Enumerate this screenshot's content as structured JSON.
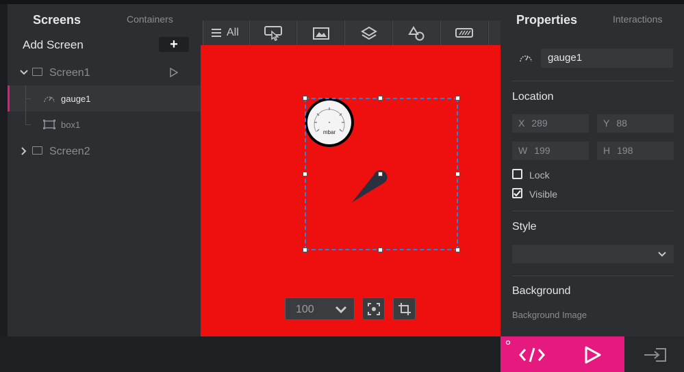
{
  "left_panel": {
    "tab_active": "Screens",
    "tab_inactive": "Containers",
    "add_screen_label": "Add Screen",
    "add_button": "+",
    "tree": {
      "screen1": "Screen1",
      "gauge1": "gauge1",
      "box1": "box1",
      "screen2": "Screen2"
    }
  },
  "toolbar": {
    "all_label": "All"
  },
  "canvas": {
    "background_color": "#ee0f0f",
    "gauge_unit": "mbar",
    "zoom_value": "100"
  },
  "right_panel": {
    "tab_active": "Properties",
    "tab_inactive": "Interactions",
    "object_name": "gauge1",
    "location_title": "Location",
    "x_label": "X",
    "x_value": "289",
    "y_label": "Y",
    "y_value": "88",
    "w_label": "W",
    "w_value": "199",
    "h_label": "H",
    "h_value": "198",
    "lock_label": "Lock",
    "lock_checked": false,
    "visible_label": "Visible",
    "visible_checked": true,
    "style_title": "Style",
    "style_value": "",
    "background_title": "Background",
    "background_image_label": "Background Image"
  },
  "colors": {
    "accent": "#e6197e",
    "selection": "#1e88e5",
    "panel": "#2c2e32"
  }
}
